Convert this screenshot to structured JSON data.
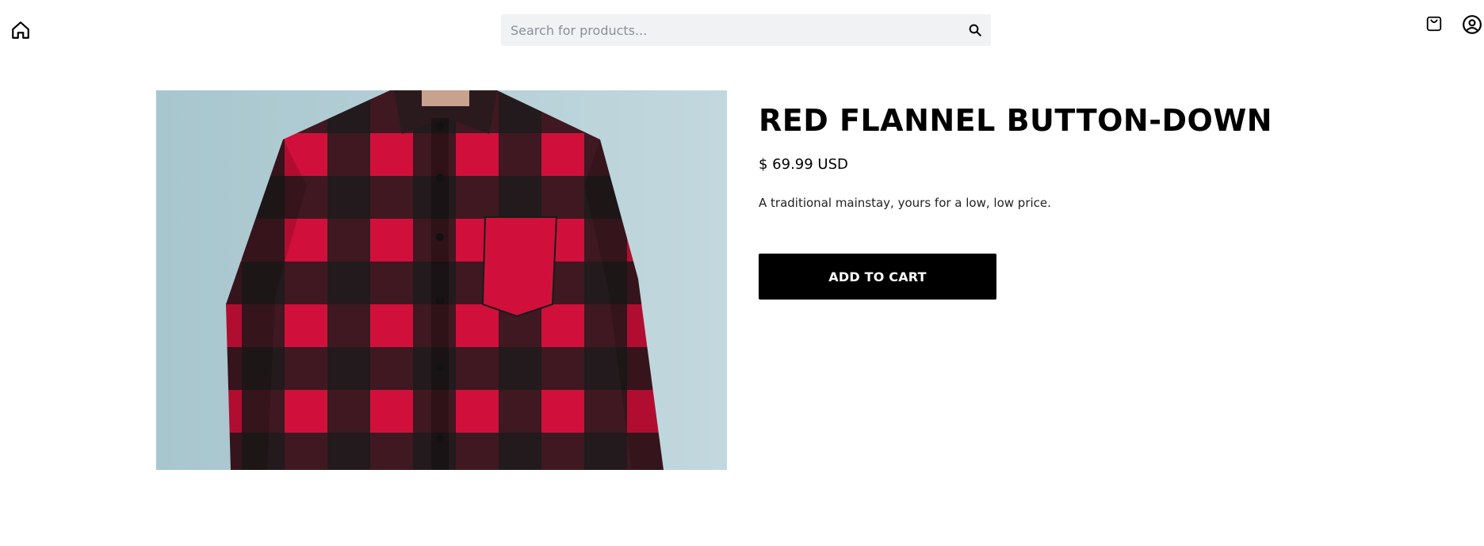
{
  "header": {
    "search_placeholder": "Search for products...",
    "icons": {
      "home": "home-icon",
      "search": "search-icon",
      "cart": "shopping-bag-icon",
      "account": "user-circle-icon"
    }
  },
  "product": {
    "image_alt": "product-photo",
    "title": "RED FLANNEL BUTTON-DOWN",
    "price": "$ 69.99 USD",
    "description": "A traditional mainstay, yours for a low, low price.",
    "add_to_cart_label": "ADD TO CART"
  },
  "colors": {
    "accent": "#000000",
    "search_bg": "#f1f2f4",
    "photo_bg": "#b7d1d9"
  }
}
